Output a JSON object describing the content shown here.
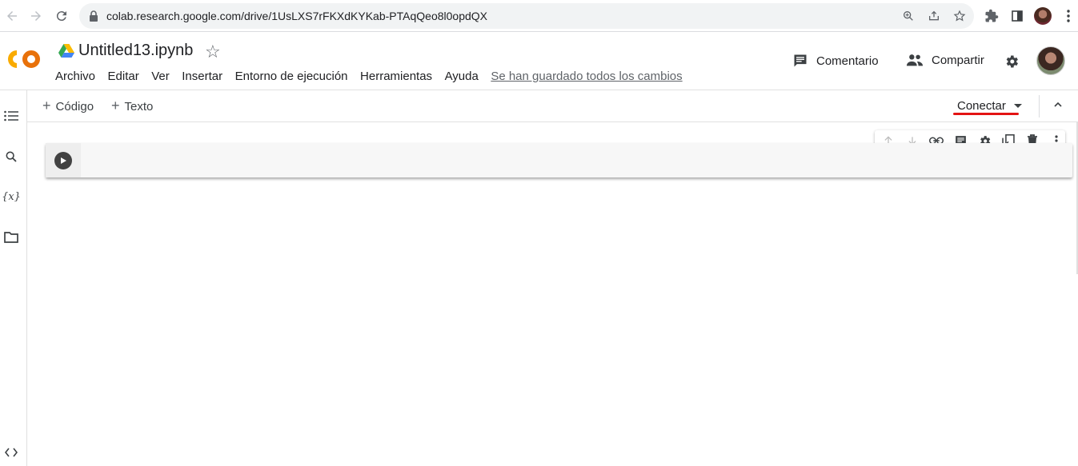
{
  "browser": {
    "url": "colab.research.google.com/drive/1UsLXS7rFKXdKYKab-PTAqQeo8l0opdQX",
    "icons": [
      "back-icon",
      "forward-icon",
      "reload-icon",
      "lock-icon",
      "zoom-icon",
      "share-icon",
      "bookmark-star-icon",
      "extensions-icon",
      "sidepanel-icon",
      "profile-avatar",
      "menu-dots-icon"
    ]
  },
  "header": {
    "logo": "CO",
    "title": "Untitled13.ipynb",
    "menu": [
      "Archivo",
      "Editar",
      "Ver",
      "Insertar",
      "Entorno de ejecución",
      "Herramientas",
      "Ayuda"
    ],
    "saved_status": "Se han guardado todos los cambios",
    "comment_label": "Comentario",
    "share_label": "Compartir"
  },
  "toolbar": {
    "add_code": "Código",
    "add_text": "Texto",
    "connect": "Conectar"
  },
  "colors": {
    "logo_yellow": "#f9ab00",
    "logo_orange": "#e8710a",
    "connect_underline": "#e31313"
  }
}
